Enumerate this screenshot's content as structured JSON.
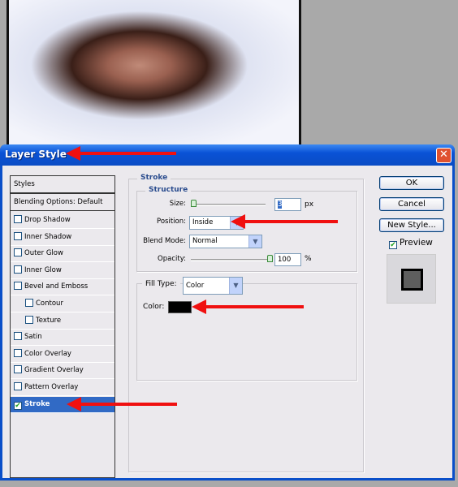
{
  "window": {
    "title": "Layer Style",
    "close_icon": "close-icon"
  },
  "sidebar": {
    "header": "Styles",
    "blending": "Blending Options: Default",
    "items": [
      {
        "label": "Drop Shadow",
        "checked": false,
        "indent": false
      },
      {
        "label": "Inner Shadow",
        "checked": false,
        "indent": false
      },
      {
        "label": "Outer Glow",
        "checked": false,
        "indent": false
      },
      {
        "label": "Inner Glow",
        "checked": false,
        "indent": false
      },
      {
        "label": "Bevel and Emboss",
        "checked": false,
        "indent": false
      },
      {
        "label": "Contour",
        "checked": false,
        "indent": true
      },
      {
        "label": "Texture",
        "checked": false,
        "indent": true
      },
      {
        "label": "Satin",
        "checked": false,
        "indent": false
      },
      {
        "label": "Color Overlay",
        "checked": false,
        "indent": false
      },
      {
        "label": "Gradient Overlay",
        "checked": false,
        "indent": false
      },
      {
        "label": "Pattern Overlay",
        "checked": false,
        "indent": false
      },
      {
        "label": "Stroke",
        "checked": true,
        "indent": false,
        "selected": true
      }
    ]
  },
  "stroke": {
    "title": "Stroke",
    "structure": {
      "title": "Structure",
      "size_label": "Size:",
      "size_value": "3",
      "size_unit": "px",
      "position_label": "Position:",
      "position_value": "Inside",
      "blend_label": "Blend Mode:",
      "blend_value": "Normal",
      "opacity_label": "Opacity:",
      "opacity_value": "100",
      "opacity_unit": "%"
    },
    "fill": {
      "type_label": "Fill Type:",
      "type_value": "Color",
      "color_label": "Color:",
      "color": "#000000"
    }
  },
  "buttons": {
    "ok": "OK",
    "cancel": "Cancel",
    "new_style": "New Style...",
    "preview_label": "Preview",
    "preview_checked": true
  },
  "colors": {
    "accent": "#316ac5",
    "title_bar": "#0a52d6",
    "arrow": "#f01010"
  }
}
